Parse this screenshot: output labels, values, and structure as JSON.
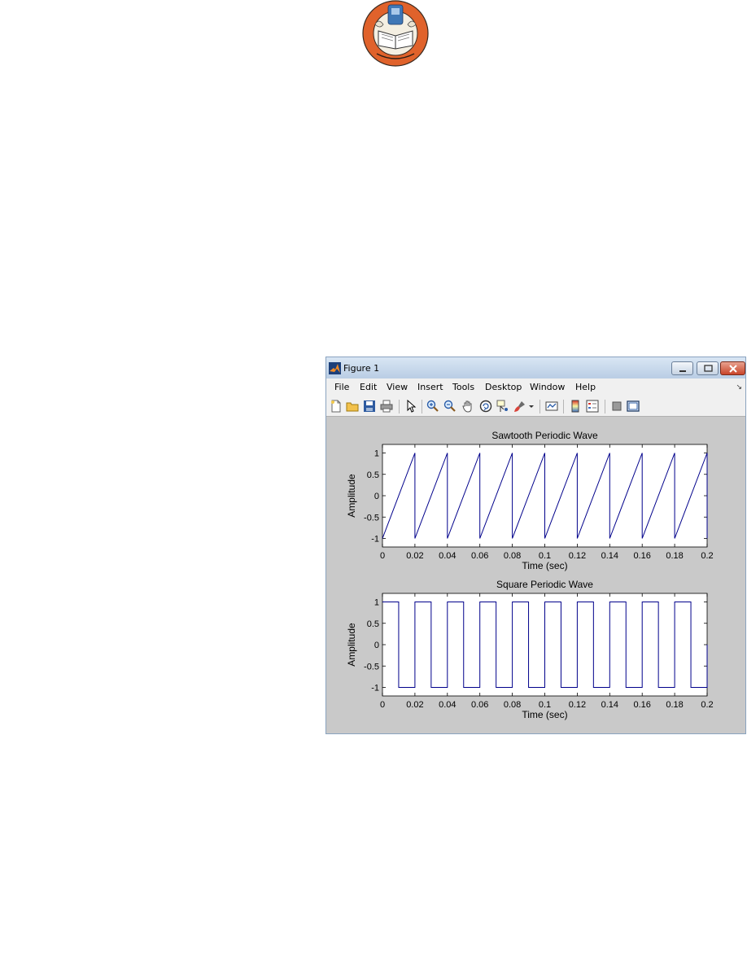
{
  "page": {
    "logo_name": "university-seal-logo"
  },
  "window": {
    "title": "Figure 1",
    "controls": [
      "minimize",
      "maximize",
      "close"
    ]
  },
  "menubar": {
    "items": [
      "File",
      "Edit",
      "View",
      "Insert",
      "Tools",
      "Desktop",
      "Window",
      "Help"
    ]
  },
  "toolbar": {
    "icons": [
      "new-figure-icon",
      "open-file-icon",
      "save-icon",
      "print-icon",
      "pointer-icon",
      "zoom-in-icon",
      "zoom-out-icon",
      "pan-hand-icon",
      "rotate-3d-icon",
      "data-cursor-icon",
      "brush-icon",
      "brush-dropdown-icon",
      "link-plot-icon",
      "colorbar-icon",
      "legend-icon",
      "hide-plot-tools-icon",
      "show-plot-tools-icon"
    ]
  },
  "chart_data": [
    {
      "type": "line",
      "title": "Sawtooth Periodic Wave",
      "xlabel": "Time (sec)",
      "ylabel": "Amplitude",
      "xlim": [
        0,
        0.2
      ],
      "ylim": [
        -1.2,
        1.2
      ],
      "xticks": [
        "0",
        "0.02",
        "0.04",
        "0.06",
        "0.08",
        "0.1",
        "0.12",
        "0.14",
        "0.16",
        "0.18",
        "0.2"
      ],
      "yticks": [
        "1",
        "0.5",
        "0",
        "-0.5",
        "-1"
      ],
      "period": 0.02,
      "series": [
        {
          "color": "#00008b",
          "x": [
            0,
            0.02,
            0.02,
            0.04,
            0.04,
            0.06,
            0.06,
            0.08,
            0.08,
            0.1,
            0.1,
            0.12,
            0.12,
            0.14,
            0.14,
            0.16,
            0.16,
            0.18,
            0.18,
            0.2,
            0.2
          ],
          "y": [
            -1,
            1,
            -1,
            1,
            -1,
            1,
            -1,
            1,
            -1,
            1,
            -1,
            1,
            -1,
            1,
            -1,
            1,
            -1,
            1,
            -1,
            1,
            -1
          ]
        }
      ],
      "grid": false
    },
    {
      "type": "line",
      "title": "Square Periodic Wave",
      "xlabel": "Time (sec)",
      "ylabel": "Amplitude",
      "xlim": [
        0,
        0.2
      ],
      "ylim": [
        -1.2,
        1.2
      ],
      "xticks": [
        "0",
        "0.02",
        "0.04",
        "0.06",
        "0.08",
        "0.1",
        "0.12",
        "0.14",
        "0.16",
        "0.18",
        "0.2"
      ],
      "yticks": [
        "1",
        "0.5",
        "0",
        "-0.5",
        "-1"
      ],
      "period": 0.02,
      "series": [
        {
          "color": "#00008b",
          "x": [
            0,
            0.01,
            0.01,
            0.02,
            0.02,
            0.03,
            0.03,
            0.04,
            0.04,
            0.05,
            0.05,
            0.06,
            0.06,
            0.07,
            0.07,
            0.08,
            0.08,
            0.09,
            0.09,
            0.1,
            0.1,
            0.11,
            0.11,
            0.12,
            0.12,
            0.13,
            0.13,
            0.14,
            0.14,
            0.15,
            0.15,
            0.16,
            0.16,
            0.17,
            0.17,
            0.18,
            0.18,
            0.19,
            0.19,
            0.2,
            0.2
          ],
          "y": [
            1,
            1,
            -1,
            -1,
            1,
            1,
            -1,
            -1,
            1,
            1,
            -1,
            -1,
            1,
            1,
            -1,
            -1,
            1,
            1,
            -1,
            -1,
            1,
            1,
            -1,
            -1,
            1,
            1,
            -1,
            -1,
            1,
            1,
            -1,
            -1,
            1,
            1,
            -1,
            -1,
            1,
            1,
            -1,
            -1,
            0
          ]
        }
      ],
      "grid": false
    }
  ]
}
